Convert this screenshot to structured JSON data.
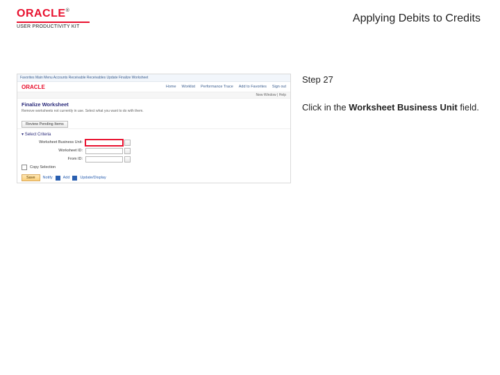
{
  "header": {
    "logo_text": "ORACLE",
    "logo_tm": "®",
    "subtitle": "USER PRODUCTIVITY KIT",
    "page_title": "Applying Debits to Credits"
  },
  "instruction": {
    "step_label": "Step 27",
    "prefix": "Click in the ",
    "bold": "Worksheet Business Unit",
    "suffix": " field."
  },
  "screenshot": {
    "breadcrumb": "Favorites   Main Menu   Accounts Receivable   Receivables Update   Finalize Worksheet",
    "oracle": "ORACLE",
    "tabs": [
      "Home",
      "Worklist",
      "Performance Trace",
      "Add to Favorites",
      "Sign out"
    ],
    "subbar": "New Window | Help",
    "section_title": "Finalize Worksheet",
    "description": "Remove worksheets not currently in use. Select what you want to do with them.",
    "review_btn": "Review Pending Items",
    "criteria": "Select Criteria",
    "fields": {
      "bu_label": "Worksheet Business Unit:",
      "bu_value": "",
      "wid_label": "Worksheet ID:",
      "wid_value": "",
      "from_label": "From ID:",
      "from_value": "",
      "copy_label": "Copy Selection"
    },
    "actions": {
      "save": "Save",
      "notify": "Notify",
      "add": "Add",
      "update": "Update/Display"
    }
  }
}
